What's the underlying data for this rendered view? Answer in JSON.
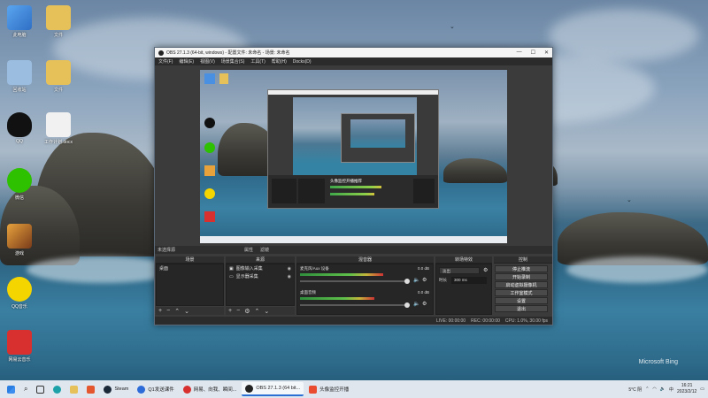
{
  "desktop_icons": [
    {
      "label": "此电脑",
      "icon": "computer-icon",
      "color": "#3d8de0"
    },
    {
      "label": "文件",
      "icon": "folder-icon",
      "color": "#e6c15a"
    },
    {
      "label": "回收站",
      "icon": "recycle-bin-icon",
      "color": "#9bbde0"
    },
    {
      "label": "文件",
      "icon": "folder-icon",
      "color": "#e6c15a"
    },
    {
      "label": "QQ",
      "icon": "qq-penguin-icon",
      "color": "#111111"
    },
    {
      "label": "工作计划.docx",
      "icon": "document-icon",
      "color": "#eeeeee"
    },
    {
      "label": "微信",
      "icon": "wechat-icon",
      "color": "#2dc100"
    },
    {
      "label": "游戏",
      "icon": "game-icon",
      "color": "#e7a23c"
    },
    {
      "label": "QQ音乐",
      "icon": "qq-music-icon",
      "color": "#f5d500"
    },
    {
      "label": "网易云音乐",
      "icon": "netease-music-icon",
      "color": "#d8302e"
    }
  ],
  "obs": {
    "title": "OBS 27.1.3 (64-bit, windows) - 配置文件: 未命名 - 场景: 未命名",
    "window_controls": [
      "—",
      "☐",
      "✕"
    ],
    "menu": [
      "文件(F)",
      "编辑(E)",
      "视图(V)",
      "场景集合(S)",
      "工具(T)",
      "帮助(H)",
      "Docks(D)"
    ],
    "context_bar": {
      "source_label": "未选择源",
      "properties": "属性",
      "filters": "滤镜"
    },
    "inner_window_text": "头像监控开播推荐",
    "panels": {
      "scenes": {
        "header": "场景",
        "items": [
          "桌面"
        ]
      },
      "sources": {
        "header": "来源",
        "items": [
          "图像输入采集",
          "显示器采集"
        ]
      },
      "mixer": {
        "header": "混音器",
        "channels": [
          {
            "name": "麦克风/Aux 设备",
            "db": "0.0 dB",
            "level": 0.78
          },
          {
            "name": "桌面音频",
            "db": "0.0 dB",
            "level": 0.7
          }
        ]
      },
      "transitions": {
        "header": "转场特效",
        "type": "淡出",
        "duration_label": "时长",
        "duration_value": "300 ms"
      },
      "controls": {
        "header": "控制",
        "buttons": [
          "停止推流",
          "开始录制",
          "启动虚拟摄像机",
          "工作室模式",
          "设置",
          "退出"
        ]
      }
    },
    "status": {
      "live": "LIVE: 00:00:00",
      "rec": "REC: 00:00:00",
      "cpu": "CPU: 1.0%, 30.00 fps"
    }
  },
  "taskbar": {
    "search_hint": "搜索",
    "items": [
      {
        "label": "Steam",
        "active": false,
        "color": "#1b2838"
      },
      {
        "label": "Q1发送课件",
        "active": false,
        "color": "#2d6cd8"
      },
      {
        "label": "网易、向我、瞬间...",
        "active": false,
        "color": "#d8302e"
      },
      {
        "label": "OBS 27.1.3 (64 bit...",
        "active": true,
        "color": "#222222"
      },
      {
        "label": "头像监控开播",
        "active": false,
        "color": "#e94c2f"
      }
    ],
    "weather": "5°C 阴",
    "time": "16:21",
    "date": "2023/2/12"
  },
  "watermark": "Microsoft Bing"
}
